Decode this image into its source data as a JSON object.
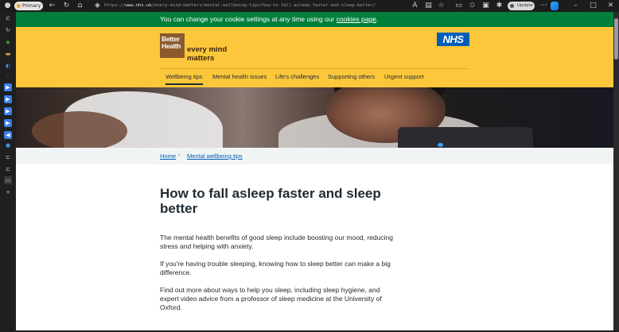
{
  "browser": {
    "profile_label": "Primary",
    "url_prefix": "https://",
    "url_domain": "www.nhs.uk",
    "url_path": "/every-mind-matters/mental-wellbeing-tips/how-to-fall-asleep-faster-and-sleep-better/",
    "update_label": "Update"
  },
  "cookie_banner": {
    "text": "You can change your cookie settings at any time using our ",
    "link": "cookies page",
    "suffix": "."
  },
  "header": {
    "logo_line1": "Better",
    "logo_line2": "Health",
    "tagline_line1": "every mind",
    "tagline_line2": "matters",
    "nhs_logo": "NHS",
    "nav": [
      {
        "label": "Wellbeing tips",
        "active": true
      },
      {
        "label": "Mental health issues",
        "active": false
      },
      {
        "label": "Life's challenges",
        "active": false
      },
      {
        "label": "Supporting others",
        "active": false
      },
      {
        "label": "Urgent support",
        "active": false
      }
    ]
  },
  "breadcrumb": {
    "home": "Home",
    "separator": "›",
    "section": "Mental wellbeing tips"
  },
  "article": {
    "title": "How to fall asleep faster and sleep better",
    "paragraphs": [
      "The mental health benefits of good sleep include boosting our mood, reducing stress and helping with anxiety.",
      "If you're having trouble sleeping, knowing how to sleep better can make a big difference.",
      "Find out more about ways to help you sleep, including sleep hygiene, and expert video advice from a professor of sleep medicine at the University of Oxford."
    ]
  },
  "colors": {
    "cookie_banner": "#007f3b",
    "header_yellow": "#fcc73b",
    "nhs_blue": "#005eb8",
    "logo_brown": "#8b5a2b",
    "text_dark": "#212b32"
  }
}
